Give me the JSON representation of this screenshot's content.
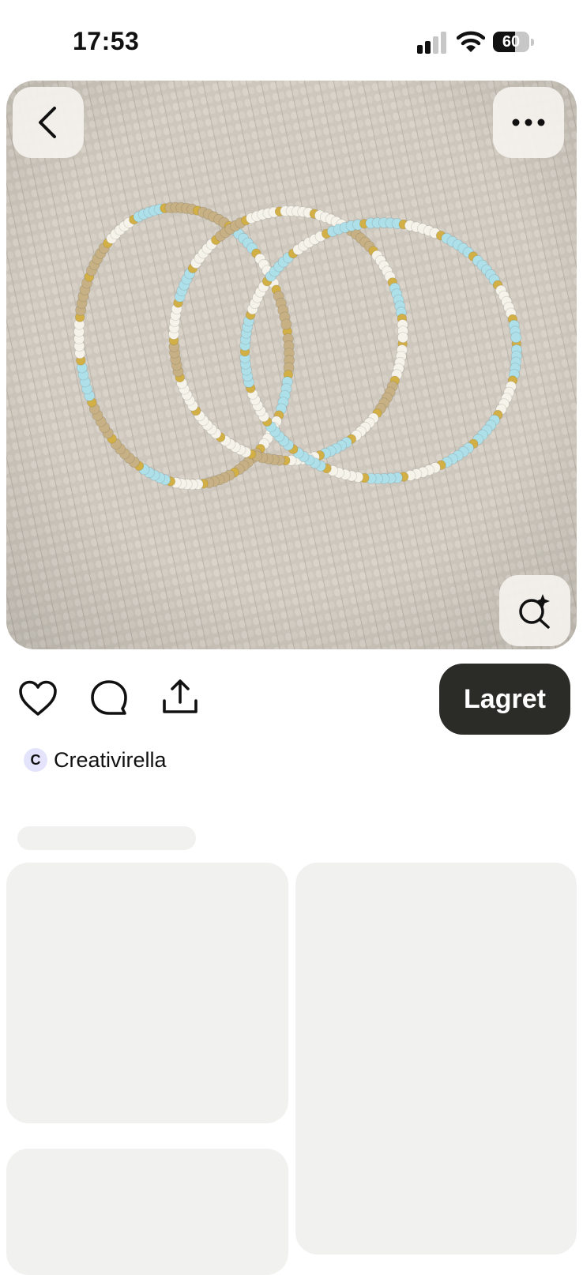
{
  "status_bar": {
    "time": "17:53",
    "battery_level": 60,
    "battery_label": "60",
    "signal_bars_active": 2,
    "signal_bars_total": 4
  },
  "pin": {
    "image_description_icon": "beaded-bracelets-photo",
    "back_icon": "chevron-left-icon",
    "more_icon": "ellipsis-icon",
    "visual_search_icon": "lens-sparkle-icon"
  },
  "actions": {
    "like_icon": "heart-icon",
    "comment_icon": "comment-icon",
    "share_icon": "share-icon",
    "save_label": "Lagret"
  },
  "creator": {
    "initial": "C",
    "name": "Creativirella"
  },
  "colors": {
    "save_button_bg": "#2b2b28",
    "skeleton": "#f1f1f0",
    "avatar_bg": "#e3e4fb",
    "bead_gold": "#d3b045",
    "bead_tan": "#c7b184",
    "bead_white": "#f6f3ea",
    "bead_blue": "#aee0ea"
  }
}
